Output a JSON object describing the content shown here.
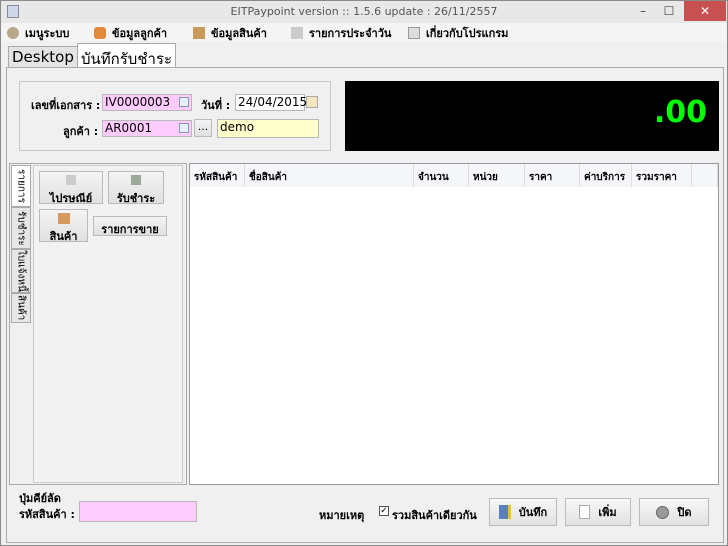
{
  "window": {
    "title": "EITPaypoint  version :: 1.5.6 update : 26/11/2557",
    "minimize": "–",
    "maximize": "☐",
    "close": "✕"
  },
  "menu": [
    {
      "label": "เมนูระบบ",
      "icon": "gear-icon"
    },
    {
      "label": "ข้อมูลลูกค้า",
      "icon": "add-user-icon"
    },
    {
      "label": "ข้อมูลสินค้า",
      "icon": "box-icon"
    },
    {
      "label": "รายการประจำวัน",
      "icon": "report-icon"
    },
    {
      "label": "เกี่ยวกับโปรแกรม",
      "icon": "info-icon"
    }
  ],
  "tabs": [
    "Desktop",
    "บันทึกรับชำระ"
  ],
  "form": {
    "doc_no_label": "เลขที่เอกสาร :",
    "doc_no": "IV0000003",
    "date_label": "วันที่ :",
    "date": "24/04/2015",
    "customer_label": "ลูกค้า :",
    "customer_code": "AR0001",
    "more": "...",
    "customer_name": "demo"
  },
  "display": {
    "total": ".00"
  },
  "side_tabs": [
    "รายการ",
    "รับชำระ",
    "ใบแจ้งหนี้",
    "สินค้า"
  ],
  "panel_buttons": [
    "ไปรษณีย์",
    "รับชำระ",
    "สินค้า",
    "รายการขาย"
  ],
  "table": {
    "columns": [
      "รหัสสินค้า",
      "ชื่อสินค้า",
      "จำนวน",
      "หน่วย",
      "ราคา",
      "ค่าบริการ",
      "รวมราคา"
    ],
    "rows": []
  },
  "footer": {
    "shortcut_label": "ปุ่มคีย์ลัด",
    "product_code_label": "รหัสสินค้า :",
    "product_code": "",
    "note_label": "หมายเหตุ",
    "merge_label": "รวมสินค้าเดียวกัน",
    "merge_checked": true,
    "save": "บันทึก",
    "add": "เพิ่ม",
    "close": "ปิด"
  },
  "colors": {
    "display_text": "#00ff00",
    "display_bg": "#000000",
    "pink_field": "#ffccff",
    "yellow_field": "#ffffcc"
  }
}
